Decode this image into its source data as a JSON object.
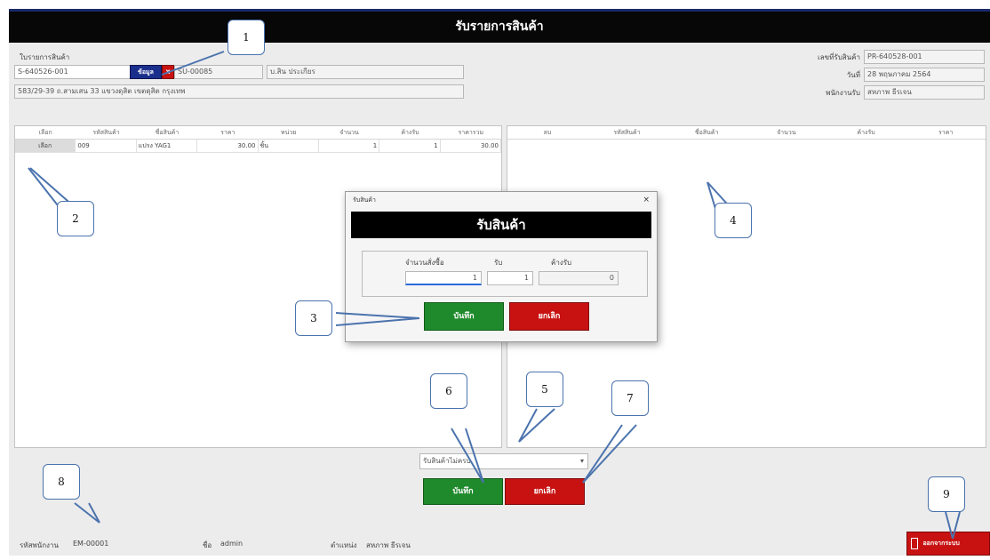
{
  "window": {
    "title": "รับรายการสินค้า"
  },
  "header": {
    "left_label": "ใบรายการสินค้า",
    "order_no": "S-640526-001",
    "data_button": "ข้อมูล",
    "supplier_code": "SU-00085",
    "supplier_name": "บ.สิน ประเกียร",
    "address": "583/29-39 ถ.สามเสน 33 แขวงดุสิต เขตดุสิต กรุงเทพ",
    "receipt_label": "เลขที่รับสินค้า",
    "receipt_no": "PR-640528-001",
    "date_label": "วันที่",
    "date_value": "28 พฤษภาคม 2564",
    "staff_label": "พนักงานรับ",
    "staff_value": "สหภาพ ธีรเจน"
  },
  "left_table": {
    "headers": [
      "เลือก",
      "รหัสสินค้า",
      "ชื่อสินค้า",
      "ราคา",
      "หน่วย",
      "จำนวน",
      "ค้างรับ",
      "ราคารวม"
    ],
    "rows": [
      [
        "เลือก",
        "009",
        "แปรง YAG1",
        "30.00",
        "ชิ้น",
        "1",
        "1",
        "30.00"
      ]
    ]
  },
  "right_table": {
    "headers": [
      "ลบ",
      "รหัสสินค้า",
      "ชื่อสินค้า",
      "จำนวน",
      "ค้างรับ",
      "ราคา"
    ]
  },
  "dialog": {
    "window_title": "รับสินค้า",
    "heading": "รับสินค้า",
    "col1": "จำนวนสั่งซื้อ",
    "col2": "รับ",
    "col3": "ค้างรับ",
    "val1": "1",
    "val2": "1",
    "val3": "0",
    "save": "บันทึก",
    "cancel": "ยกเลิก"
  },
  "bottom": {
    "select_value": "รับสินค้าไม่ครบ",
    "save": "บันทึก",
    "cancel": "ยกเลิก"
  },
  "status": {
    "emp_label": "รหัสพนักงาน",
    "emp_value": "EM-00001",
    "name_label": "ชื่อ",
    "name_value": "admin",
    "position_label": "ตำแหน่ง",
    "position_value": "สหภาพ ธีรเจน",
    "exit_label": "ออกจากระบบ"
  },
  "callouts": [
    "1",
    "2",
    "3",
    "4",
    "5",
    "6",
    "7",
    "8",
    "9"
  ],
  "colors": {
    "green": "#1f8a2c",
    "red": "#c81212",
    "blue_button": "#1a2f8c",
    "titlebar": "#070707"
  }
}
